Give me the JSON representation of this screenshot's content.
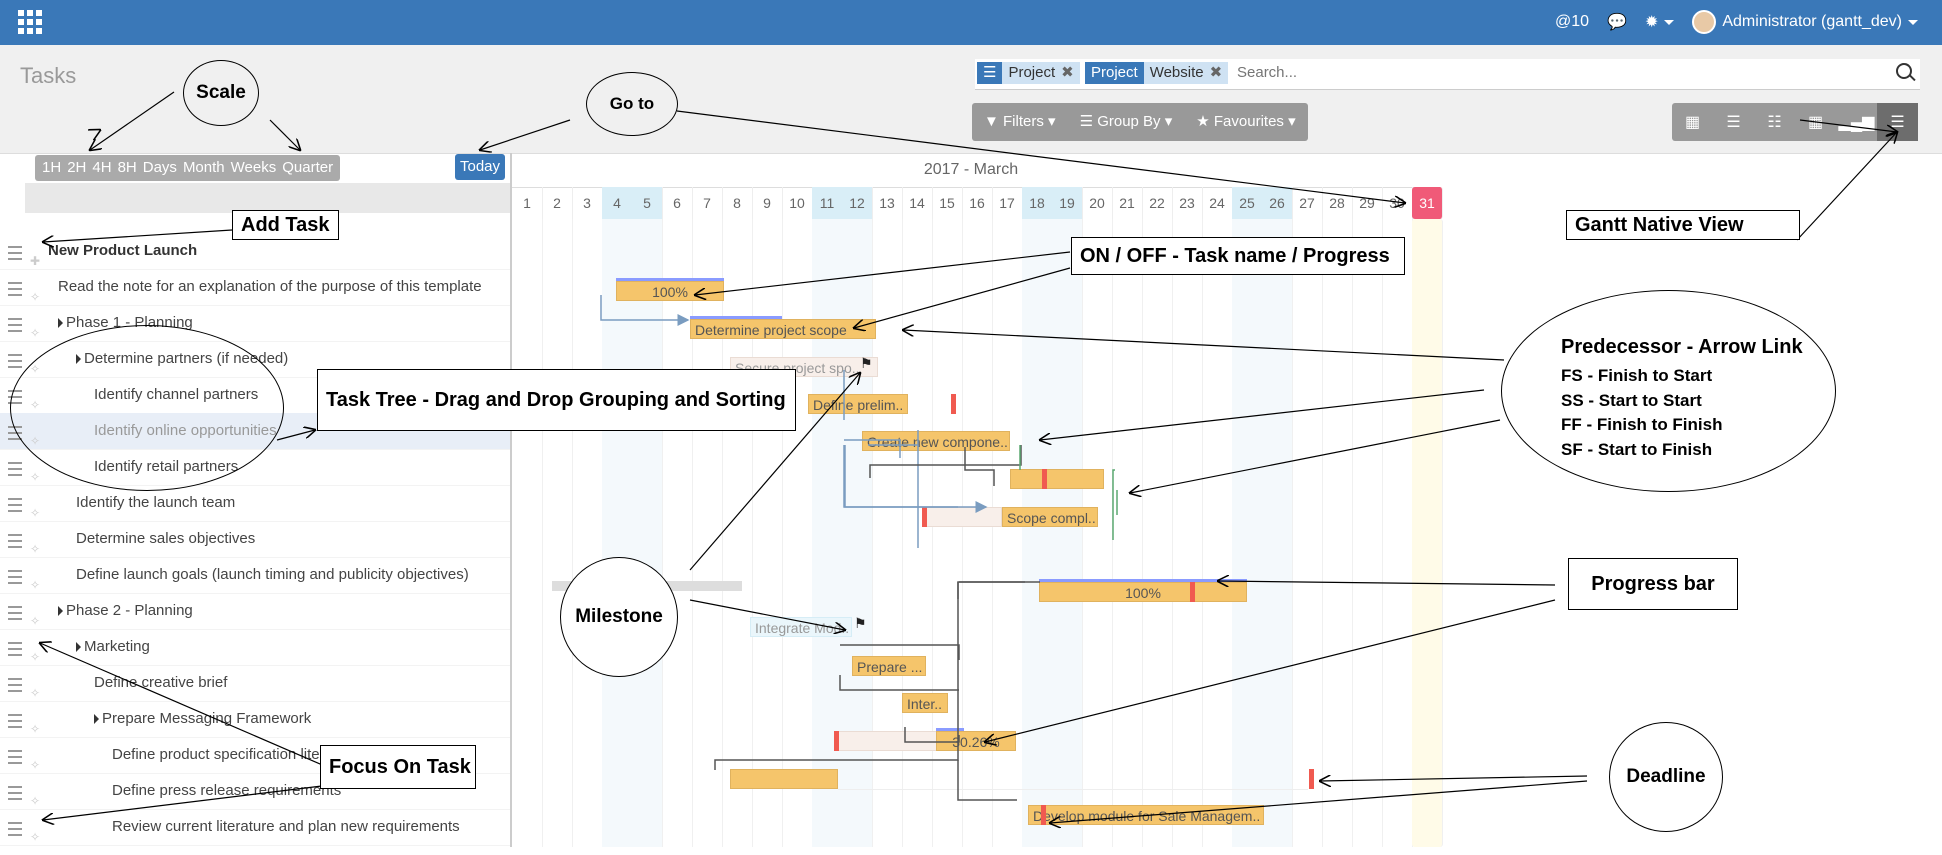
{
  "topbar": {
    "mentions": "@10",
    "user": "Administrator (gantt_dev)"
  },
  "control_panel": {
    "breadcrumb": "Tasks",
    "facets": [
      {
        "label": "",
        "value": "Project"
      },
      {
        "label": "Project",
        "value": "Website"
      }
    ],
    "search_placeholder": "Search...",
    "filters_label": "Filters",
    "group_by_label": "Group By",
    "favourites_label": "Favourites",
    "views": [
      "kanban",
      "list",
      "calendar",
      "pivot",
      "graph",
      "gantt"
    ],
    "active_view": "gantt"
  },
  "scale": {
    "options": [
      "1H",
      "2H",
      "4H",
      "8H",
      "Days",
      "Month",
      "Weeks",
      "Quarter"
    ],
    "today_label": "Today"
  },
  "tasks": [
    {
      "name": "New Product Launch",
      "bold": true
    },
    {
      "name": "Read the note for an explanation of the purpose of this template"
    },
    {
      "name": "Phase 1 - Planning"
    },
    {
      "name": "Determine partners (if needed)"
    },
    {
      "name": "Identify channel partners"
    },
    {
      "name": "Identify online opportunities"
    },
    {
      "name": "Identify retail partners"
    },
    {
      "name": "Identify the launch team"
    },
    {
      "name": "Determine sales objectives"
    },
    {
      "name": "Define launch goals (launch timing and publicity objectives)"
    },
    {
      "name": "Phase 2 - Planning"
    },
    {
      "name": "Marketing"
    },
    {
      "name": "Define creative brief"
    },
    {
      "name": "Prepare Messaging Framework"
    },
    {
      "name": "Define product specification literature"
    },
    {
      "name": "Define press release requirements"
    },
    {
      "name": "Review current literature and plan new requirements"
    }
  ],
  "gantt": {
    "month_label": "2017 - March",
    "weekend_days": [
      4,
      5,
      11,
      12,
      18,
      19,
      25,
      26
    ],
    "today_day": 31,
    "bars": [
      {
        "label": "100%",
        "progress": 1.0
      },
      {
        "label": "Determine project scope"
      },
      {
        "label": "Secure project spo.."
      },
      {
        "label": "Define prelim.."
      },
      {
        "label": "Create new compone.."
      },
      {
        "label": ""
      },
      {
        "label": "Scope compl.."
      },
      {
        "label": "100%",
        "progress": 1.0
      },
      {
        "label": "Integrate Mod.."
      },
      {
        "label": "Prepare ..."
      },
      {
        "label": "Inter.."
      },
      {
        "label": "30.26%",
        "progress": 0.3026
      },
      {
        "label": ""
      },
      {
        "label": "Develop module for Sale Managem.."
      }
    ],
    "milestone_handle": "...."
  },
  "annotations": {
    "scale": "Scale",
    "go_to": "Go to",
    "add_task": "Add Task",
    "on_off": "ON / OFF - Task name / Progress",
    "gantt_native_view": "Gantt Native View",
    "task_tree": "Task Tree - Drag and Drop Grouping and Sorting",
    "predecessor_title": "Predecessor - Arrow Link",
    "predecessor_lines": [
      "FS - Finish to Start",
      "SS - Start to Start",
      "FF - Finish to Finish",
      "SF - Start to Finish"
    ],
    "milestone": "Milestone",
    "progress_bar": "Progress bar",
    "focus_on_task": "Focus On Task",
    "deadline": "Deadline"
  }
}
